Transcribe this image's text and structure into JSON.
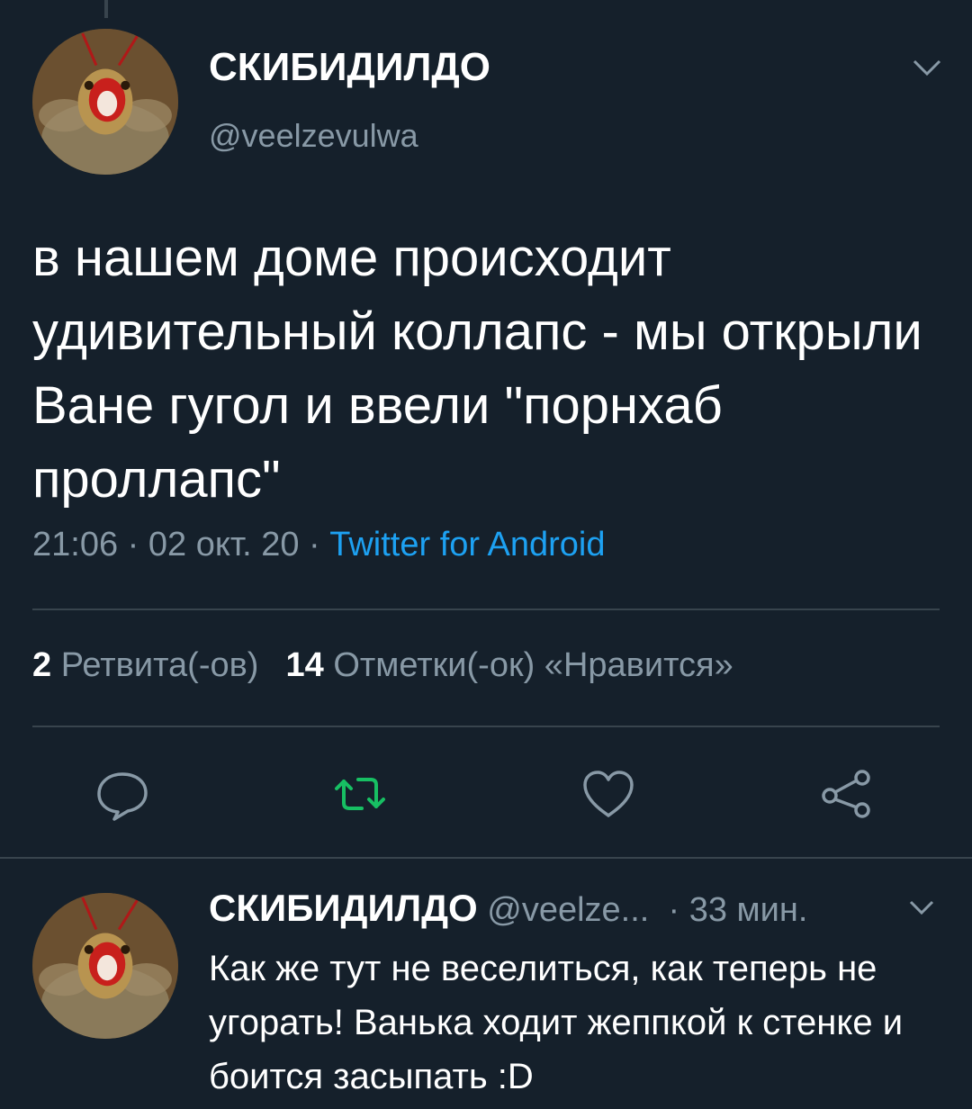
{
  "tweet": {
    "display_name": "СКИБИДИЛДО",
    "handle": "@veelzevulwa",
    "text": "в нашем доме происходит удивительный коллапс - мы открыли Ване гугол и ввели \"порнхаб проллапс\"",
    "time": "21:06",
    "date": "02 окт. 20",
    "separator": "·",
    "source": "Twitter for Android",
    "retweets_count": "2",
    "retweets_label": "Ретвита(-ов)",
    "likes_count": "14",
    "likes_label": "Отметки(-ок) «Нравится»",
    "source_color": "#1da1f2",
    "retweet_icon_color": "#17bf63"
  },
  "reply": {
    "display_name": "СКИБИДИЛДО",
    "handle": "@veelze...",
    "separator": "·",
    "time_ago": "33 мин.",
    "text": "Как же тут не веселиться, как теперь не угорать! Ванька ходит жеппкой к стенке и боится засыпать :D"
  },
  "icons": {
    "reply": "reply-icon",
    "retweet": "retweet-icon",
    "like": "heart-icon",
    "share": "share-icon",
    "menu": "chevron-down-icon"
  },
  "theme": {
    "background": "#15202b",
    "secondary_text": "#8899a6",
    "divider": "#38444d"
  }
}
